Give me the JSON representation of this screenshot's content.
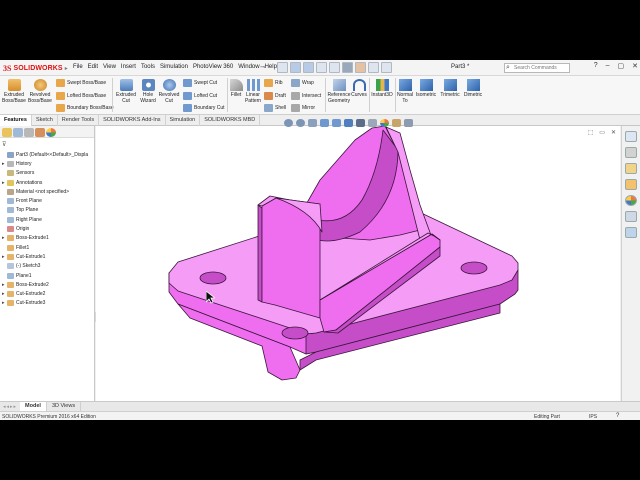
{
  "app": {
    "logo_ds": "3S",
    "logo_text": "SOLIDWORKS",
    "menu": [
      "File",
      "Edit",
      "View",
      "Insert",
      "Tools",
      "Simulation",
      "PhotoView 360",
      "Window",
      "Help"
    ],
    "pin_icon": "pushpin-icon",
    "doc_title": "Part3 *",
    "search_placeholder": "Search Commands",
    "window_controls": [
      "?",
      "–",
      "▢",
      "✕"
    ]
  },
  "command_manager": {
    "extruded_boss": "Extruded Boss/Base",
    "revolved_boss": "Revolved Boss/Base",
    "swept_boss": "Swept Boss/Base",
    "lofted_boss": "Lofted Boss/Base",
    "boundary_boss": "Boundary Boss/Base",
    "extruded_cut": "Extruded Cut",
    "hole_wizard": "Hole Wizard",
    "revolved_cut": "Revolved Cut",
    "swept_cut": "Swept Cut",
    "lofted_cut": "Lofted Cut",
    "boundary_cut": "Boundary Cut",
    "fillet": "Fillet",
    "linear_pattern": "Linear Pattern",
    "rib": "Rib",
    "draft": "Draft",
    "shell": "Shell",
    "wrap": "Wrap",
    "intersect": "Intersect",
    "mirror": "Mirror",
    "reference_geometry": "Reference Geometry",
    "curves": "Curves",
    "instant3d": "Instant3D",
    "normal_to": "Normal To",
    "isometric": "Isometric",
    "trimetric": "Trimetric",
    "dimetric": "Dimetric"
  },
  "tabs": [
    "Features",
    "Sketch",
    "Render Tools",
    "SOLIDWORKS Add-Ins",
    "Simulation",
    "SOLIDWORKS MBD"
  ],
  "feature_tree": {
    "filter_icon": "filter-icon",
    "nodes": [
      {
        "label": "Part3  (Default<<Default>_Displa",
        "exp": "",
        "color": "#8aa4c8",
        "level": 0
      },
      {
        "label": "History",
        "exp": "▸",
        "color": "#b8b8b8",
        "level": 0
      },
      {
        "label": "Sensors",
        "exp": "",
        "color": "#c9b87c",
        "level": 0
      },
      {
        "label": "Annotations",
        "exp": "▸",
        "color": "#e0c45e",
        "level": 0
      },
      {
        "label": "Material <not specified>",
        "exp": "",
        "color": "#b9a58a",
        "level": 0
      },
      {
        "label": "Front Plane",
        "exp": "",
        "color": "#9fb9d6",
        "level": 0
      },
      {
        "label": "Top Plane",
        "exp": "",
        "color": "#9fb9d6",
        "level": 0
      },
      {
        "label": "Right Plane",
        "exp": "",
        "color": "#9fb9d6",
        "level": 0
      },
      {
        "label": "Origin",
        "exp": "",
        "color": "#d88a8a",
        "level": 0
      },
      {
        "label": "Boss-Extrude1",
        "exp": "▸",
        "color": "#e6b36a",
        "level": 0
      },
      {
        "label": "Fillet1",
        "exp": "",
        "color": "#e6b36a",
        "level": 0
      },
      {
        "label": "Cut-Extrude1",
        "exp": "▸",
        "color": "#e6b36a",
        "level": 0
      },
      {
        "label": "(-) Sketch3",
        "exp": "",
        "color": "#b5c6da",
        "level": 0
      },
      {
        "label": "Plane1",
        "exp": "",
        "color": "#9fb9d6",
        "level": 0
      },
      {
        "label": "Boss-Extrude2",
        "exp": "▸",
        "color": "#e6b36a",
        "level": 0
      },
      {
        "label": "Cut-Extrude2",
        "exp": "▸",
        "color": "#e6b36a",
        "level": 0
      },
      {
        "label": "Cut-Extrude3",
        "exp": "▸",
        "color": "#e6b36a",
        "level": 0
      }
    ]
  },
  "viewport": {
    "controls": [
      "⬚",
      "▭",
      "✕"
    ],
    "part_color": "#ef6ef0",
    "part_color_dark": "#c54ec8",
    "part_color_light": "#f59cf6",
    "edge_color": "#3b163c"
  },
  "bottom_tabs": [
    "Model",
    "3D Views"
  ],
  "nav_arrows": "◂◂▸▸",
  "status": {
    "left": "SOLIDWORKS Premium 2016 x64 Edition",
    "mode": "Editing Part",
    "units": "IPS",
    "help": "?"
  }
}
